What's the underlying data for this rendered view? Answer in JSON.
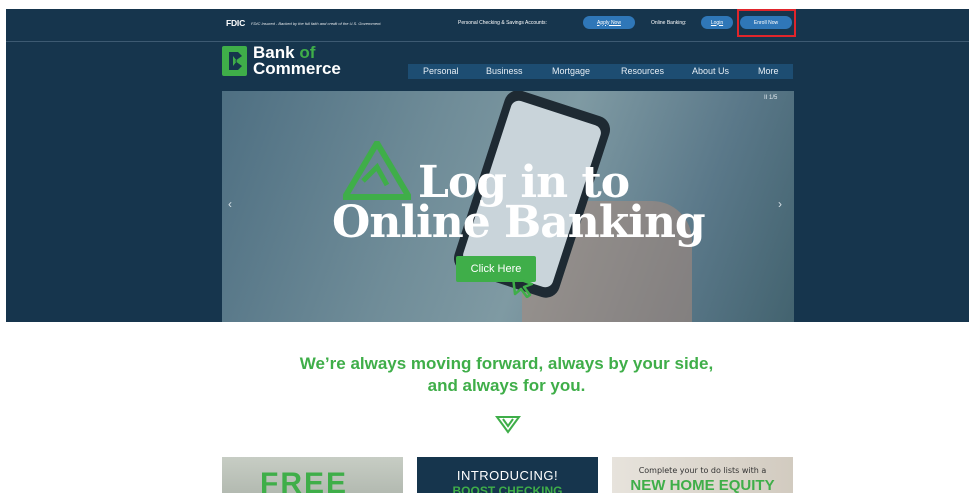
{
  "topbar": {
    "fdic_logo": "FDIC",
    "fdic_text": "FDIC Insured - Backed by the full faith and credit of the U.S. Government.",
    "accounts_text": "Personal Checking & Savings Accounts:",
    "apply_label": "Apply Now",
    "online_banking_text": "Online Banking:",
    "login_label": "Login",
    "enroll_label": "Enroll Now"
  },
  "brand": {
    "name_line1": "Bank",
    "name_of": "of",
    "name_line2": "Commerce",
    "color_green": "#3fae49",
    "color_navy": "#16354d"
  },
  "nav": {
    "items": [
      "Personal",
      "Business",
      "Mortgage",
      "Resources",
      "About Us",
      "More"
    ]
  },
  "hero": {
    "line1": "Log in to",
    "line2": "Online Banking",
    "cta_label": "Click Here",
    "pager": "II  1/5",
    "prev_arrow": "‹",
    "next_arrow": "›"
  },
  "tagline": {
    "line1": "We’re always moving forward, always by your side,",
    "line2": "and always for you."
  },
  "promos": [
    {
      "text": "FREE"
    },
    {
      "line1": "INTRODUCING!",
      "line2": "BOOST CHECKING"
    },
    {
      "line1": "Complete your to do lists with a",
      "line2": "NEW HOME EQUITY"
    }
  ]
}
